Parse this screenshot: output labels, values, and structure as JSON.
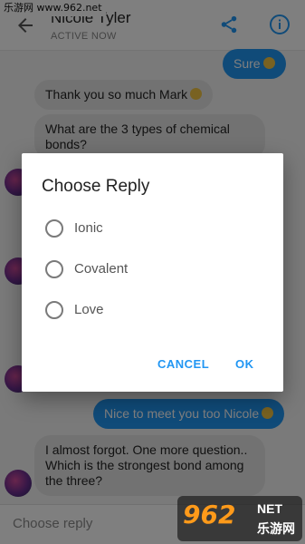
{
  "watermark": {
    "site": "乐游网 www.962.net"
  },
  "header": {
    "contact_name": "Nicole Tyler",
    "status": "ACTIVE NOW",
    "icons": {
      "back": "arrow-left-icon",
      "share": "share-icon",
      "info": "info-icon"
    },
    "accent_color": "#2196f3"
  },
  "messages": [
    {
      "side": "out",
      "text": "Sure",
      "emoji": true
    },
    {
      "side": "in",
      "text": "Thank you so much Mark",
      "emoji": true
    },
    {
      "side": "in",
      "text": "What are the 3 types of chemical bonds?",
      "emoji": false
    },
    {
      "side": "out",
      "text": "Nice to meet you too Nicole",
      "emoji": true
    },
    {
      "side": "in",
      "text": "I almost forgot. One more question.. Which is the strongest bond among the three?",
      "emoji": false
    }
  ],
  "bottombar": {
    "placeholder": "Choose reply"
  },
  "dialog": {
    "title": "Choose Reply",
    "options": [
      "Ionic",
      "Covalent",
      "Love"
    ],
    "cancel_label": "CANCEL",
    "ok_label": "OK"
  },
  "logo": {
    "number": "962",
    "net": "NET",
    "cn": "乐游网"
  }
}
